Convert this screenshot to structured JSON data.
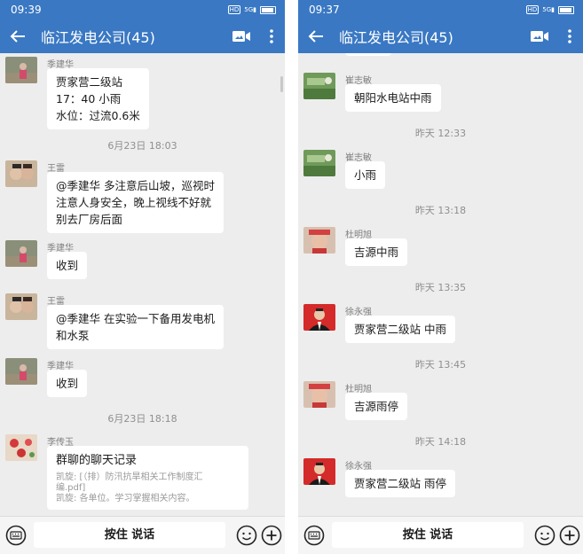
{
  "colors": {
    "header": "#3a78c3",
    "background": "#ededed",
    "bubble": "#ffffff"
  },
  "screens": [
    {
      "status_time": "09:39",
      "title": "临江发电公司(45)",
      "voice_label": "按住 说话",
      "messages": [
        {
          "sender": "季建华",
          "lines": [
            "贾家营二级站",
            "17：40 小雨",
            "水位：过流0.6米"
          ]
        },
        {
          "timestamp": "6月23日 18:03"
        },
        {
          "sender": "王雷",
          "lines": [
            "@季建华 多注意后山坡，巡视时",
            "注意人身安全，晚上视线不好就",
            "别去厂房后面"
          ]
        },
        {
          "sender": "季建华",
          "lines": [
            "收到"
          ]
        },
        {
          "sender": "王雷",
          "lines": [
            "@季建华 在实验一下备用发电机",
            "和水泵"
          ]
        },
        {
          "sender": "季建华",
          "lines": [
            "收到"
          ]
        },
        {
          "timestamp": "6月23日 18:18"
        },
        {
          "sender": "李传玉",
          "card_title": "群聊的聊天记录",
          "card_lines": [
            "凯旋: [（排）防汛抗旱相关工作制度汇",
            "编.pdf]",
            "凯旋: 各单位。学习掌握相关内容。"
          ]
        }
      ]
    },
    {
      "status_time": "09:37",
      "title": "临江发电公司(45)",
      "voice_label": "按住 说话",
      "messages": [
        {
          "sender": "崔志敏",
          "lines": [
            "朝阳水电站中雨"
          ]
        },
        {
          "timestamp": "昨天 12:33"
        },
        {
          "sender": "崔志敏",
          "lines": [
            "小雨"
          ]
        },
        {
          "timestamp": "昨天 13:18"
        },
        {
          "sender": "杜明旭",
          "lines": [
            "吉源中雨"
          ]
        },
        {
          "timestamp": "昨天 13:35"
        },
        {
          "sender": "徐永强",
          "lines": [
            "贾家营二级站 中雨"
          ]
        },
        {
          "timestamp": "昨天 13:45"
        },
        {
          "sender": "杜明旭",
          "lines": [
            "吉源雨停"
          ]
        },
        {
          "timestamp": "昨天 14:18"
        },
        {
          "sender": "徐永强",
          "lines": [
            "贾家营二级站 雨停"
          ]
        }
      ]
    }
  ]
}
